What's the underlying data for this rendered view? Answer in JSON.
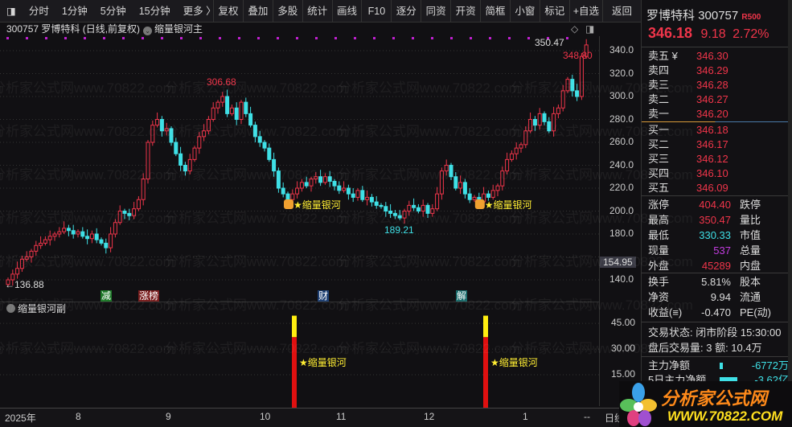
{
  "toolbar": {
    "left_tabs": [
      "分时",
      "1分钟",
      "5分钟",
      "15分钟",
      "更多 〉"
    ],
    "buttons": [
      "复权",
      "叠加",
      "多股",
      "统计",
      "画线",
      "F10",
      "逐分",
      "同资",
      "开资",
      "简框",
      "小窗",
      "标记",
      "+自选",
      "返回"
    ]
  },
  "chart_info": {
    "code_name": "300757 罗博特科 (日线,前复权)",
    "indicator": "缩量银河主"
  },
  "main_chart": {
    "max_label": "306.68",
    "min_label": "189.21",
    "start_label": "←136.88",
    "last_high_label": "350.47",
    "last_label": "348.80",
    "current_price_tag": "154.95",
    "signal_label": "★缩量银河",
    "event_badges": [
      {
        "text": "减",
        "color": "#1f7a2a"
      },
      {
        "text": "涨榜",
        "color": "#7a1e1e"
      },
      {
        "text": "财",
        "color": "#1d3f73"
      },
      {
        "text": "解",
        "color": "#1a6b6b"
      }
    ]
  },
  "chart_data": {
    "type": "candlestick",
    "y_axis_ticks": [
      "340.0",
      "320.0",
      "300.0",
      "280.0",
      "260.0",
      "240.0",
      "220.0",
      "200.0",
      "180.0",
      "140.0"
    ],
    "ylim": [
      140,
      340
    ],
    "closes": [
      140,
      145,
      150,
      158,
      160,
      165,
      170,
      172,
      175,
      178,
      180,
      182,
      185,
      183,
      180,
      182,
      178,
      176,
      180,
      175,
      172,
      168,
      180,
      190,
      200,
      198,
      196,
      202,
      210,
      228,
      260,
      275,
      280,
      270,
      272,
      260,
      250,
      240,
      235,
      245,
      255,
      265,
      270,
      280,
      290,
      295,
      300,
      285,
      290,
      280,
      295,
      285,
      275,
      265,
      260,
      255,
      245,
      235,
      220,
      215,
      210,
      215,
      220,
      225,
      222,
      228,
      230,
      225,
      230,
      226,
      222,
      218,
      220,
      215,
      212,
      218,
      210,
      212,
      208,
      205,
      204,
      200,
      198,
      196,
      194,
      200,
      205,
      203,
      200,
      205,
      198,
      202,
      215,
      235,
      240,
      230,
      220,
      225,
      215,
      210,
      212,
      208,
      215,
      212,
      218,
      222,
      235,
      245,
      250,
      255,
      258,
      270,
      280,
      275,
      285,
      278,
      270,
      285,
      290,
      305,
      315,
      305,
      300,
      335,
      345
    ],
    "signal_indices": [
      60,
      101
    ],
    "x_ticks": [
      "2025年",
      "8",
      "9",
      "10",
      "11",
      "12",
      "1",
      "--"
    ]
  },
  "sub_chart": {
    "title": "缩量银河副",
    "y_axis_ticks": [
      "45.00",
      "30.00",
      "15.00"
    ],
    "signal_label": "★缩量银河",
    "bars": [
      {
        "red": 37,
        "yellow": 12.5
      },
      {
        "red": 37,
        "yellow": 12.5
      }
    ]
  },
  "time_axis": {
    "right_label": "日线"
  },
  "panel": {
    "name": "罗博特科",
    "code": "300757",
    "tag": "R500",
    "price": "346.18",
    "change": "9.18",
    "pct": "2.72%",
    "asks": [
      {
        "label": "卖五 ¥",
        "price": "346.30"
      },
      {
        "label": "卖四",
        "price": "346.29"
      },
      {
        "label": "卖三",
        "price": "346.28"
      },
      {
        "label": "卖二",
        "price": "346.27"
      },
      {
        "label": "卖一",
        "price": "346.20"
      }
    ],
    "bids": [
      {
        "label": "买一",
        "price": "346.18"
      },
      {
        "label": "买二",
        "price": "346.17"
      },
      {
        "label": "买三",
        "price": "346.12"
      },
      {
        "label": "买四",
        "price": "346.10"
      },
      {
        "label": "买五",
        "price": "346.09"
      }
    ],
    "stats": [
      {
        "l": "涨停",
        "v": "404.40",
        "c": "red",
        "l2": "跌停"
      },
      {
        "l": "最高",
        "v": "350.47",
        "c": "red",
        "l2": "量比"
      },
      {
        "l": "最低",
        "v": "330.33",
        "c": "cyan",
        "l2": "市值"
      },
      {
        "l": "现量",
        "v": "537",
        "c": "mag",
        "l2": "总量"
      },
      {
        "l": "外盘",
        "v": "45289",
        "c": "red",
        "l2": "内盘"
      }
    ],
    "stats2": [
      {
        "l": "换手",
        "v": "5.81%",
        "l2": "股本"
      },
      {
        "l": "净资",
        "v": "9.94",
        "l2": "流通"
      },
      {
        "l": "收益(≡)",
        "v": "-0.470",
        "l2": "PE(动)"
      }
    ],
    "trade_status": "交易状态: 闭市阶段 15:30:00",
    "after_hours": "盘后交易量: 3  额: 10.4万",
    "main_net_label": "主力净额",
    "main_net_value": "-6772万",
    "five_day_label": "5日主力净额",
    "five_day_value": "-3.62亿"
  },
  "watermark": "分析家公式网www.70822.com",
  "logo": {
    "title": "分析家公式网",
    "url": "WWW.70822.COM"
  }
}
